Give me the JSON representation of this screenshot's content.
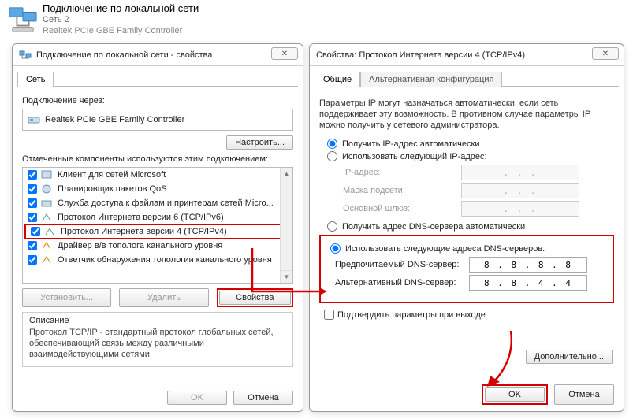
{
  "header": {
    "title": "Подключение по локальной сети",
    "subtitle": "Сеть  2",
    "device": "Realtek PCIe GBE Family Controller"
  },
  "dlg1": {
    "title": "Подключение по локальной сети - свойства",
    "tab_net": "Сеть",
    "connect_via_label": "Подключение через:",
    "adapter": "Realtek PCIe GBE Family Controller",
    "configure_btn": "Настроить...",
    "components_label": "Отмеченные компоненты используются этим подключением:",
    "items": [
      "Клиент для сетей Microsoft",
      "Планировщик пакетов QoS",
      "Служба доступа к файлам и принтерам сетей Micro...",
      "Протокол Интернета версии 6 (TCP/IPv6)",
      "Протокол Интернета версии 4 (TCP/IPv4)",
      "Драйвер в/в тополога канального уровня",
      "Ответчик обнаружения топологии канального уровня"
    ],
    "install_btn": "Установить...",
    "uninstall_btn": "Удалить",
    "properties_btn": "Свойства",
    "desc_legend": "Описание",
    "desc_text": "Протокол TCP/IP - стандартный протокол глобальных сетей, обеспечивающий связь между различными взаимодействующими сетями.",
    "ok": "OK",
    "cancel": "Отмена"
  },
  "dlg2": {
    "title": "Свойства: Протокол Интернета версии 4 (TCP/IPv4)",
    "tab_general": "Общие",
    "tab_alt": "Альтернативная конфигурация",
    "info": "Параметры IP могут назначаться автоматически, если сеть поддерживает эту возможность. В противном случае параметры IP можно получить у сетевого администратора.",
    "ip_auto": "Получить IP-адрес автоматически",
    "ip_manual": "Использовать следующий IP-адрес:",
    "ip_label": "IP-адрес:",
    "mask_label": "Маска подсети:",
    "gw_label": "Основной шлюз:",
    "dns_auto": "Получить адрес DNS-сервера автоматически",
    "dns_manual": "Использовать следующие адреса DNS-серверов:",
    "dns_pref_label": "Предпочитаемый DNS-сервер:",
    "dns_alt_label": "Альтернативный DNS-сервер:",
    "dns_pref_value": "8 . 8 . 8 . 8",
    "dns_alt_value": "8 . 8 . 4 . 4",
    "ip_dots": ".     .     .",
    "confirm": "Подтвердить параметры при выходе",
    "advanced": "Дополнительно...",
    "ok": "OK",
    "cancel": "Отмена"
  }
}
